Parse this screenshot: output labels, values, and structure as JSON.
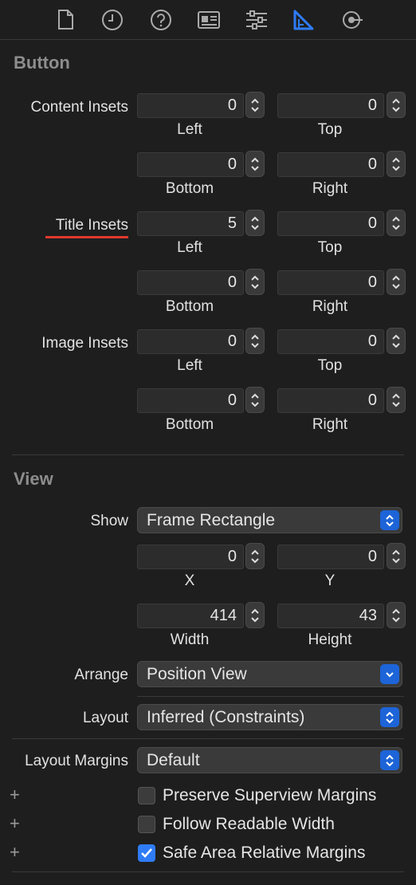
{
  "toolbar": {
    "icons": [
      "file-icon",
      "history-icon",
      "help-icon",
      "identity-icon",
      "attributes-icon",
      "size-ruler-icon",
      "connections-icon"
    ],
    "active_index": 5,
    "active_color": "#2e7cf6"
  },
  "button_section": {
    "title": "Button",
    "content_insets": {
      "label": "Content Insets",
      "left": "0",
      "top": "0",
      "bottom": "0",
      "right": "0"
    },
    "title_insets": {
      "label": "Title Insets",
      "left": "5",
      "top": "0",
      "bottom": "0",
      "right": "0",
      "underline_color": "#e0392e"
    },
    "image_insets": {
      "label": "Image Insets",
      "left": "0",
      "top": "0",
      "bottom": "0",
      "right": "0"
    },
    "sub_labels": {
      "left": "Left",
      "top": "Top",
      "bottom": "Bottom",
      "right": "Right"
    }
  },
  "view_section": {
    "title": "View",
    "show": {
      "label": "Show",
      "value": "Frame Rectangle"
    },
    "x": {
      "value": "0",
      "label": "X"
    },
    "y": {
      "value": "0",
      "label": "Y"
    },
    "width": {
      "value": "414",
      "label": "Width"
    },
    "height": {
      "value": "43",
      "label": "Height"
    },
    "arrange": {
      "label": "Arrange",
      "value": "Position View"
    },
    "layout": {
      "label": "Layout",
      "value": "Inferred (Constraints)"
    },
    "layout_margins": {
      "label": "Layout Margins",
      "value": "Default"
    },
    "checkboxes": [
      {
        "label": "Preserve Superview Margins",
        "checked": false
      },
      {
        "label": "Follow Readable Width",
        "checked": false
      },
      {
        "label": "Safe Area Relative Margins",
        "checked": true
      }
    ],
    "plus_symbol": "+"
  }
}
